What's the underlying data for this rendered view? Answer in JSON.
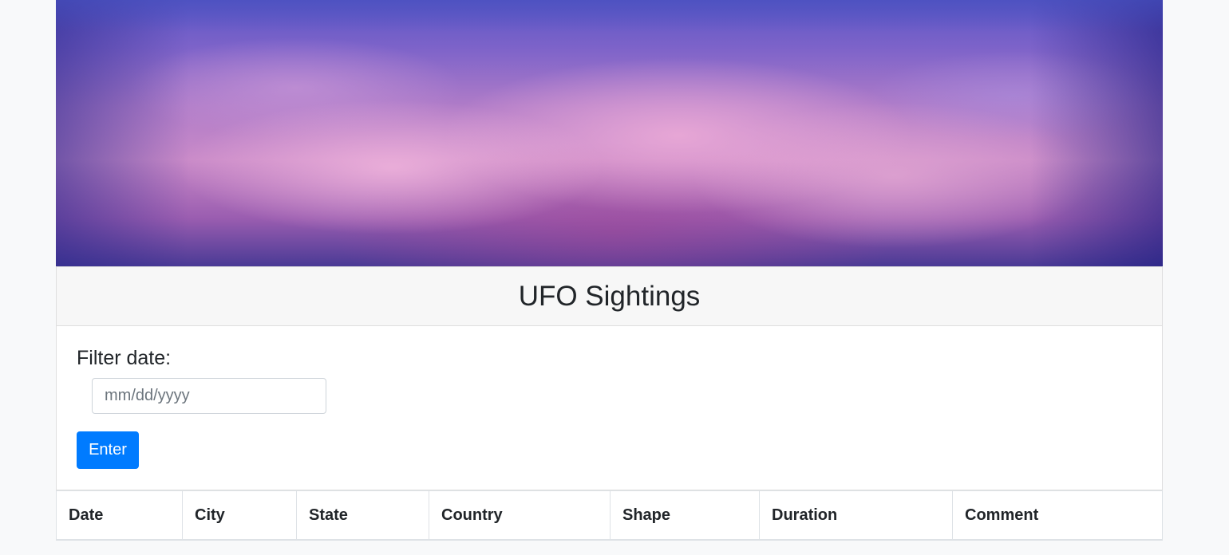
{
  "header": {
    "title": "UFO Sightings"
  },
  "filter": {
    "label": "Filter date:",
    "date_placeholder": "mm/dd/yyyy",
    "date_value": "",
    "button_label": "Enter"
  },
  "table": {
    "columns": [
      "Date",
      "City",
      "State",
      "Country",
      "Shape",
      "Duration",
      "Comment"
    ]
  },
  "colors": {
    "accent": "#007bff",
    "page_background": "#f8f9fa",
    "header_background": "#f7f7f7"
  }
}
